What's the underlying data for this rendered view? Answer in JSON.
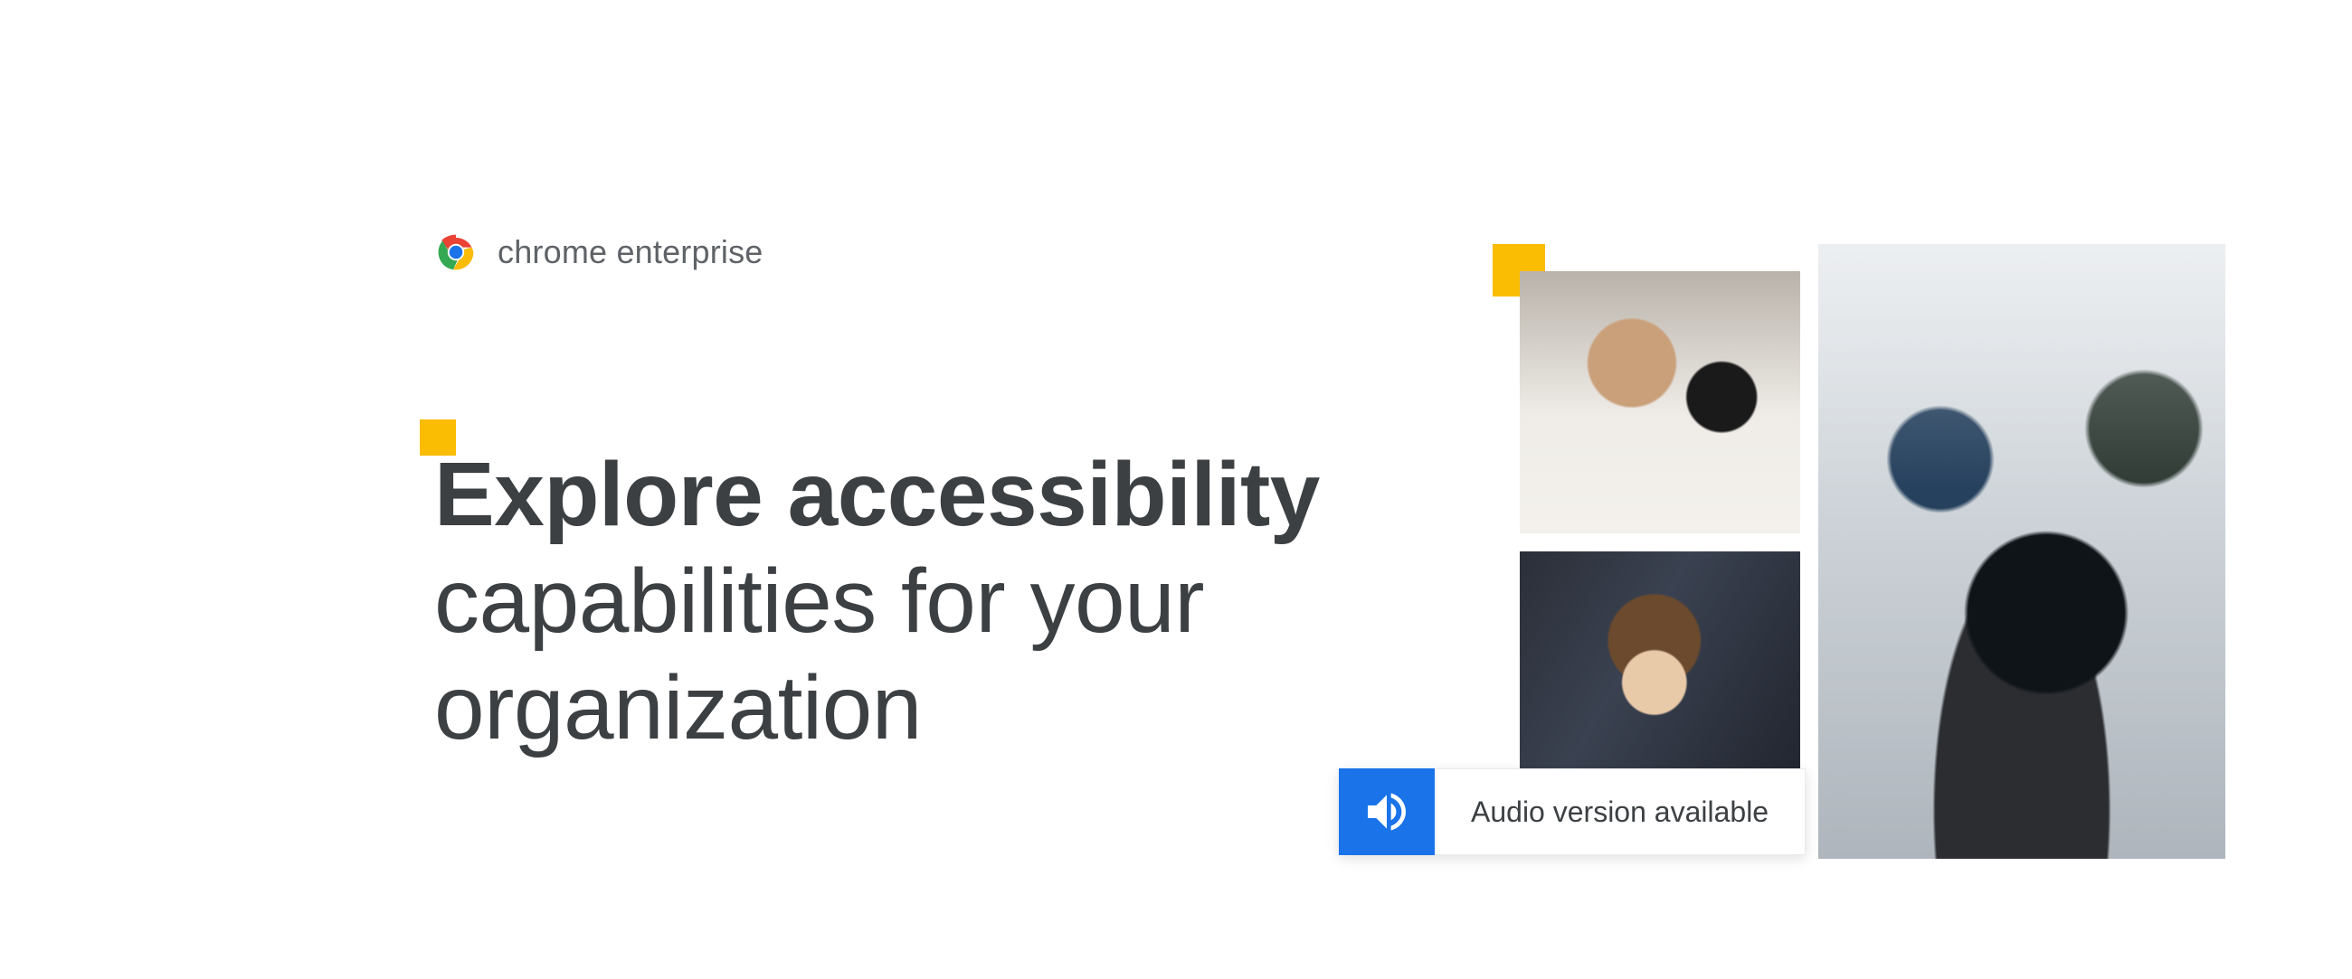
{
  "brand": {
    "product": "chrome enterprise"
  },
  "headline": {
    "strong": "Explore accessibility",
    "rest_line1": "capabilities for your",
    "rest_line2": "organization"
  },
  "audio_badge": {
    "label": "Audio version available"
  },
  "accent_color": "#fbbc04",
  "primary_blue": "#1a73e8"
}
